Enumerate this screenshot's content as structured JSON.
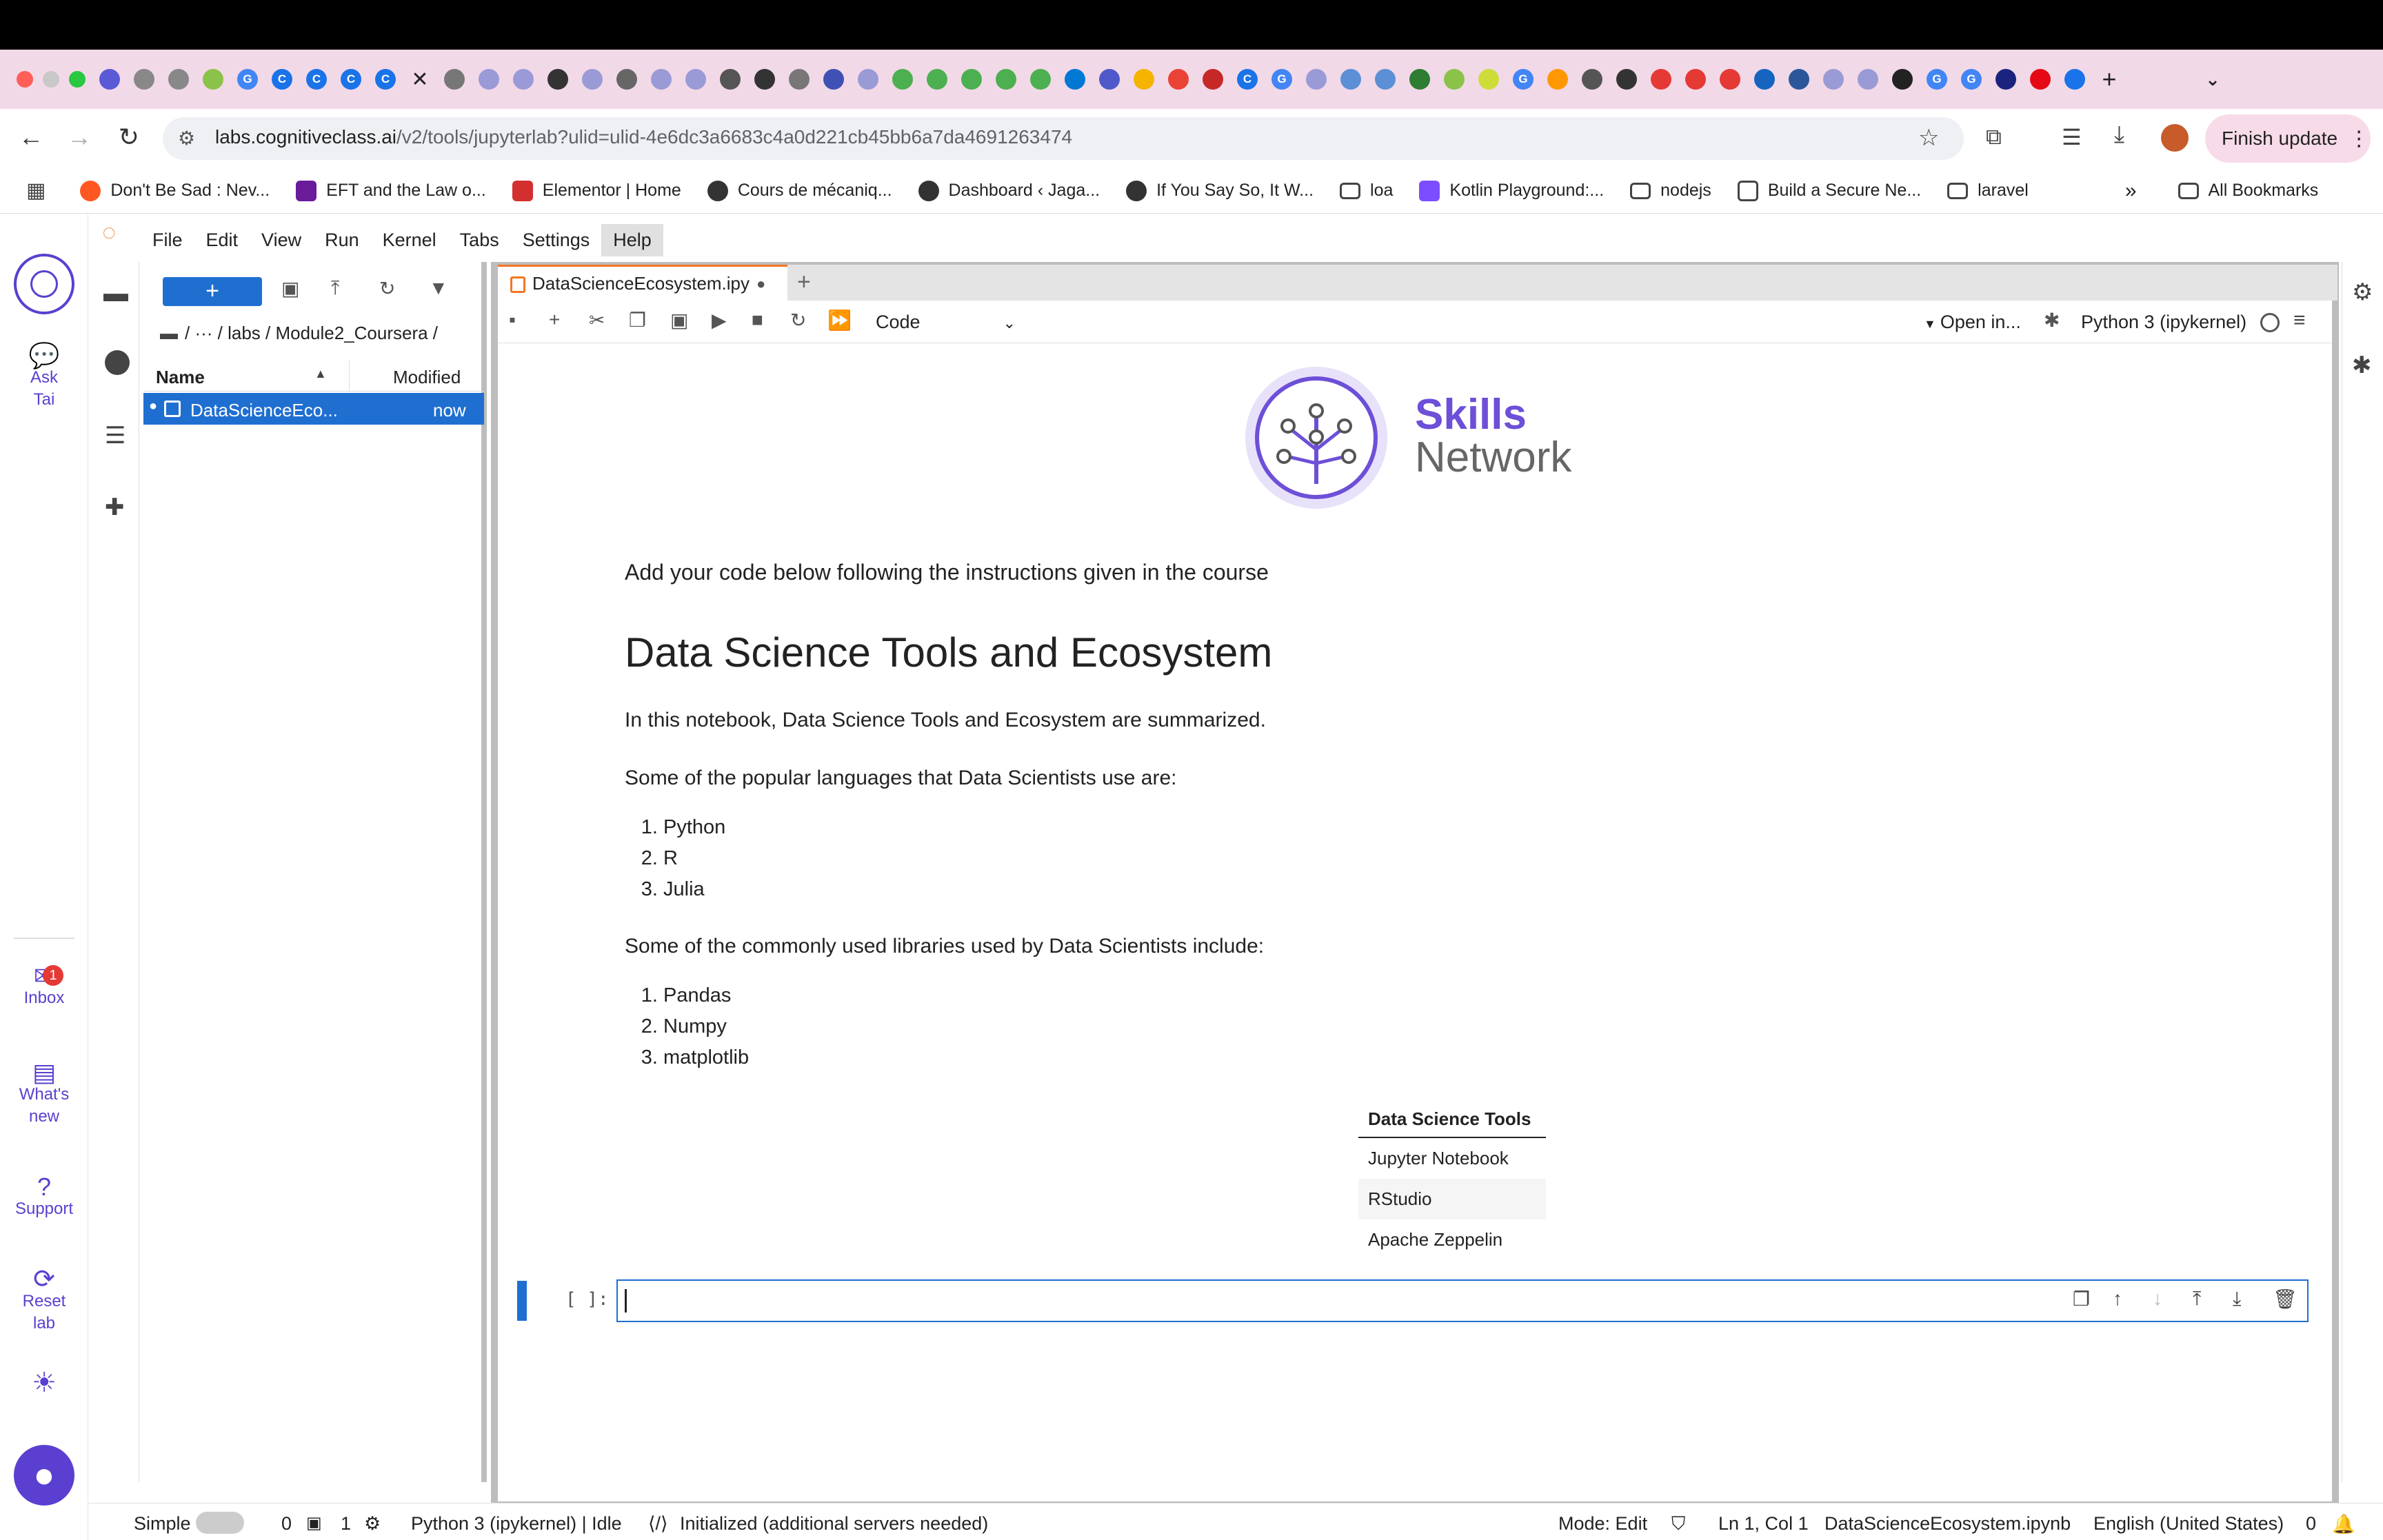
{
  "browser": {
    "url_host": "labs.cognitiveclass.ai",
    "url_path": "/v2/tools/jupyterlab?ulid=ulid-4e6dc3a6683c4a0d221cb45bb6a7da4691263474",
    "finish_update": "Finish update",
    "bookmarks": [
      "Don't Be Sad : Nev...",
      "EFT and the Law o...",
      "Elementor | Home",
      "Cours de mécaniq...",
      "Dashboard ‹ Jaga...",
      "If You Say So, It W...",
      "loa",
      "Kotlin Playground:...",
      "nodejs",
      "Build a Secure Ne...",
      "laravel"
    ],
    "all_bookmarks": "All Bookmarks",
    "overflow": "»"
  },
  "rail": {
    "ask": "Ask",
    "tai": "Tai",
    "inbox": "Inbox",
    "inbox_count": "1",
    "whats": "What's",
    "new": "new",
    "support": "Support",
    "reset": "Reset",
    "lab": "lab"
  },
  "menu": [
    "File",
    "Edit",
    "View",
    "Run",
    "Kernel",
    "Tabs",
    "Settings",
    "Help"
  ],
  "filebrowser": {
    "new_label": "+",
    "breadcrumb": "/   ···   / labs / Module2_Coursera /",
    "col_name": "Name",
    "col_modified": "Modified",
    "file_name": "DataScienceEco...",
    "file_modified": "now"
  },
  "notebook": {
    "tab_title": "DataScienceEcosystem.ipy",
    "celltype": "Code",
    "open_in": "Open in...",
    "kernel": "Python 3 (ipykernel)",
    "logo_line1": "Skills",
    "logo_line2": "Network",
    "intro": "Add your code below following the instructions given in the course",
    "title": "Data Science Tools and Ecosystem",
    "summary": "In this notebook, Data Science Tools and Ecosystem are summarized.",
    "languages_intro": "Some of the popular languages that Data Scientists use are:",
    "languages": [
      "Python",
      "R",
      "Julia"
    ],
    "libraries_intro": "Some of the commonly used libraries used by Data Scientists include:",
    "libraries": [
      "Pandas",
      "Numpy",
      "matplotlib"
    ],
    "table_header": "Data Science Tools",
    "tools": [
      "Jupyter Notebook",
      "RStudio",
      "Apache Zeppelin"
    ],
    "prompt": "[ ]:"
  },
  "status": {
    "simple": "Simple",
    "terminals": "0",
    "kernels": "1",
    "kernel_state": "Python 3 (ipykernel) | Idle",
    "lsp": "Initialized (additional servers needed)",
    "mode": "Mode: Edit",
    "position": "Ln 1, Col 1",
    "filename": "DataScienceEcosystem.ipynb",
    "language": "English (United States)",
    "notifications": "0"
  }
}
